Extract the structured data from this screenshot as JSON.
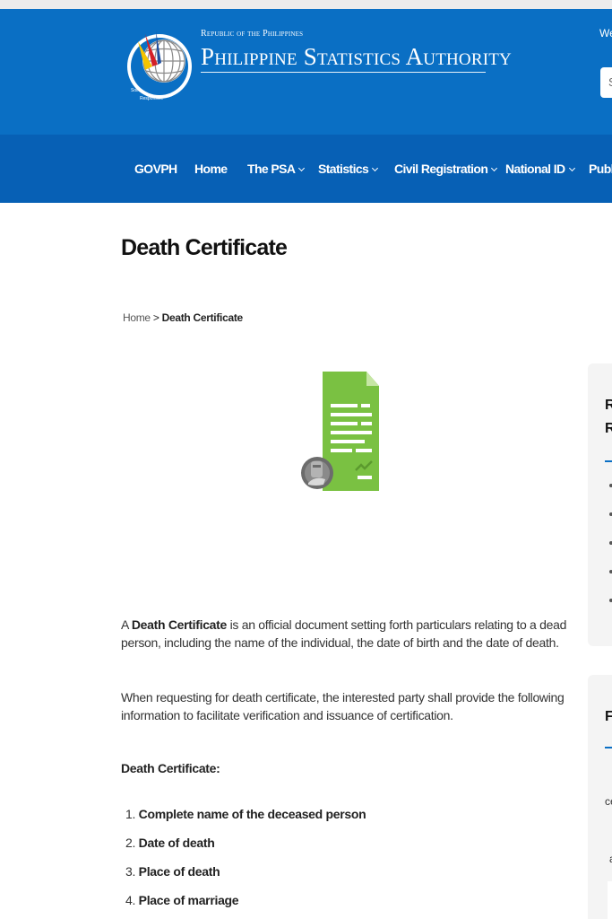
{
  "header": {
    "republic": "Republic of the Philippines",
    "agency": "Philippine Statistics Authority",
    "welcome": "We",
    "search_placeholder": "S",
    "logo_name": "psa-seal-logo",
    "colors": {
      "header_bg": "#0a6fc4",
      "nav_bg": "#0760b5"
    }
  },
  "nav": {
    "items": [
      {
        "label": "GOVPH",
        "dropdown": false
      },
      {
        "label": "Home",
        "dropdown": false
      },
      {
        "label": "The PSA",
        "dropdown": true
      },
      {
        "label": "Statistics",
        "dropdown": true
      },
      {
        "label": "Civil Registration",
        "dropdown": true
      },
      {
        "label": "National ID",
        "dropdown": true
      },
      {
        "label": "Publi",
        "dropdown": false
      }
    ]
  },
  "page": {
    "title": "Death Certificate",
    "breadcrumb": {
      "home": "Home",
      "separator": ">",
      "current": "Death Certificate"
    },
    "illustration": "death-certificate-document-icon",
    "intro": {
      "prefix": "A ",
      "bold": "Death Certificate",
      "rest": " is an official document setting forth particulars relating to a dead person, including the name of the individual, the date of birth and the date of death."
    },
    "para2": "When requesting for death certificate, the interested party shall provide the following information to facilitate verification and issuance of certification.",
    "subhead": "Death Certificate:",
    "requirements": [
      {
        "num": "1.",
        "label": "Complete name of the deceased person"
      },
      {
        "num": "2.",
        "label": "Date of death"
      },
      {
        "num": "3.",
        "label": "Place of death"
      },
      {
        "num": "4.",
        "label": "Place of marriage"
      }
    ]
  },
  "sidebar": {
    "card1": {
      "title_line1": "R",
      "title_line2": "R"
    },
    "card2": {
      "title": "F",
      "text1": "ce",
      "text2": "a"
    }
  }
}
